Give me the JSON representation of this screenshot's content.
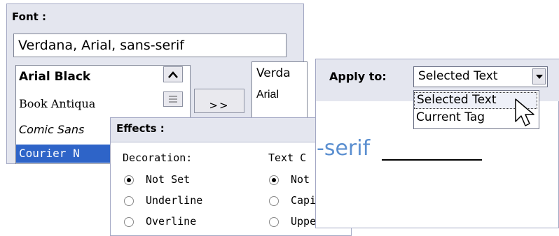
{
  "font_panel": {
    "heading": "Font :",
    "input_value": "Verdana, Arial, sans-serif",
    "available_fonts": [
      "Arial Black",
      "Book Antiqua",
      "Comic Sans",
      "Courier N"
    ],
    "add_button_label": ">>",
    "selected_fonts": [
      "Verda",
      "Arial"
    ]
  },
  "effects_panel": {
    "heading": "Effects :",
    "decoration": {
      "label": "Decoration:",
      "options": [
        "Not Set",
        "Underline",
        "Overline"
      ],
      "selected": "Not Set"
    },
    "text_case": {
      "label": "Text C",
      "options": [
        "Not Set",
        "Capitali",
        "Upperca"
      ],
      "selected": "Not Set"
    }
  },
  "apply_panel": {
    "label": "Apply to:",
    "selected_value": "Selected Text",
    "options": [
      "Selected Text",
      "Current Tag"
    ],
    "highlighted_option": "Selected Text"
  },
  "preview": {
    "text": "-serif"
  },
  "colors": {
    "panel_bg": "#e4e6ef",
    "selection_blue": "#2e64c8",
    "preview_blue": "#5b8fd0"
  }
}
